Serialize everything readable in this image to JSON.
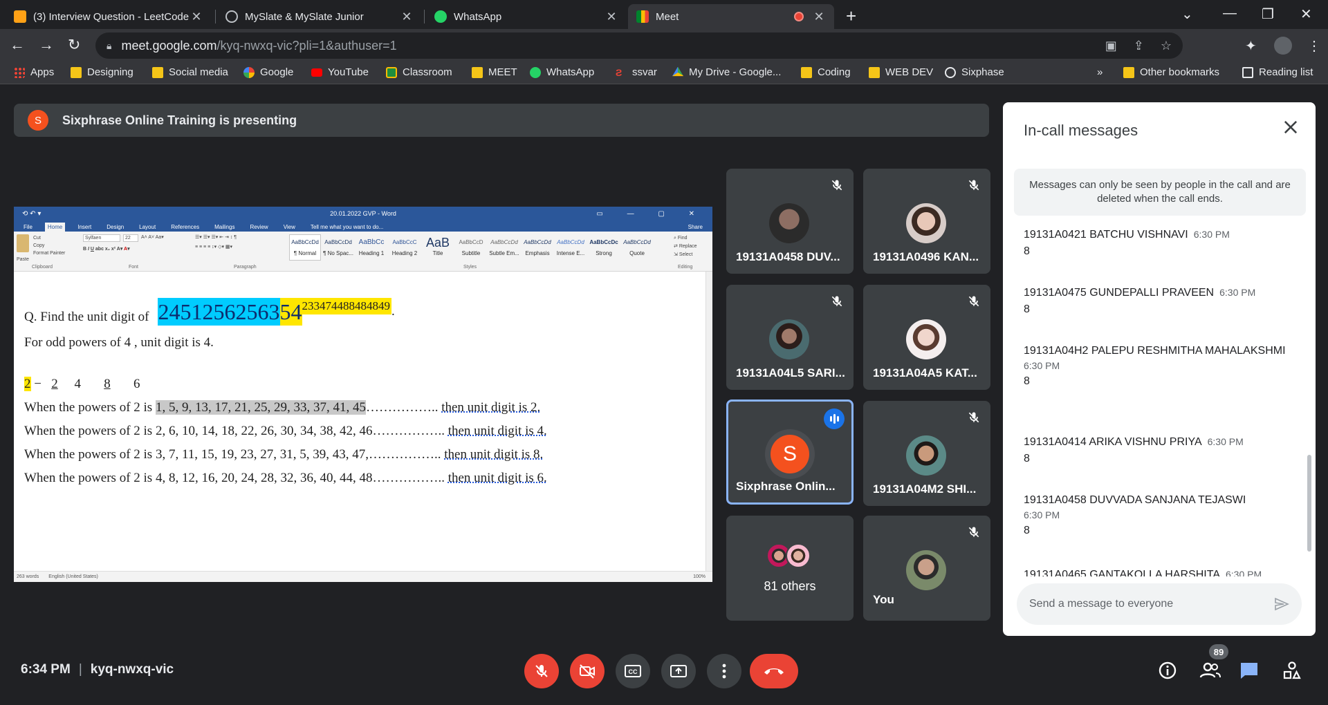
{
  "browser": {
    "tabs": [
      {
        "label": "(3) Interview Question - LeetCode",
        "icon": "leetcode-icon"
      },
      {
        "label": "MySlate & MySlate Junior",
        "icon": "globe-icon"
      },
      {
        "label": "WhatsApp",
        "icon": "whatsapp-icon"
      },
      {
        "label": "Meet",
        "icon": "meet-icon"
      }
    ],
    "url_host": "meet.google.com",
    "url_path": "/kyq-nwxq-vic?pli=1&authuser=1",
    "bookmarks": [
      {
        "label": "Apps"
      },
      {
        "label": "Designing"
      },
      {
        "label": "Social media"
      },
      {
        "label": "Google"
      },
      {
        "label": "YouTube"
      },
      {
        "label": "Classroom"
      },
      {
        "label": "MEET"
      },
      {
        "label": "WhatsApp"
      },
      {
        "label": "ssvar"
      },
      {
        "label": "My Drive - Google..."
      },
      {
        "label": "Coding"
      },
      {
        "label": "WEB DEV"
      },
      {
        "label": "Sixphase"
      }
    ],
    "overflow": "»",
    "other_bookmarks": "Other bookmarks",
    "reading_list": "Reading list"
  },
  "presenting": {
    "avatar_letter": "S",
    "text": "Sixphrase Online Training is presenting"
  },
  "word": {
    "title": "20.01.2022 GVP - Word",
    "tabs": [
      "File",
      "Home",
      "Insert",
      "Design",
      "Layout",
      "References",
      "Mailings",
      "Review",
      "View",
      "Tell me what you want to do..."
    ],
    "share": "Share",
    "font": "Sylfaen",
    "font_size": "22",
    "clipboard_items": [
      "Cut",
      "Copy",
      "Format Painter"
    ],
    "paste": "Paste",
    "group_labels": [
      "Clipboard",
      "Font",
      "Paragraph",
      "Styles",
      "Editing"
    ],
    "styles": [
      {
        "sample": "AaBbCcDd",
        "name": "¶ Normal"
      },
      {
        "sample": "AaBbCcDd",
        "name": "¶ No Spac..."
      },
      {
        "sample": "AaBbCc",
        "name": "Heading 1"
      },
      {
        "sample": "AaBbCcC",
        "name": "Heading 2"
      },
      {
        "sample": "AaB",
        "name": "Title"
      },
      {
        "sample": "AaBbCcD",
        "name": "Subtitle"
      },
      {
        "sample": "AaBbCcDd",
        "name": "Subtle Em..."
      },
      {
        "sample": "AaBbCcDd",
        "name": "Emphasis"
      },
      {
        "sample": "AaBbCcDd",
        "name": "Intense E..."
      },
      {
        "sample": "AaBbCcDc",
        "name": "Strong"
      },
      {
        "sample": "AaBbCcDd",
        "name": "Quote"
      }
    ],
    "editing": [
      "Find",
      "Replace",
      "Select"
    ],
    "question_prefix": "Q. Find the unit digit of",
    "question_number": "24512562563",
    "question_base": "54",
    "question_exponent": "233474488484849",
    "question_period": ".",
    "line_odd": "For odd powers of 4 , unit digit is 4.",
    "cycle": [
      "2",
      "−",
      "2",
      "4",
      "8",
      "6"
    ],
    "rules": [
      {
        "pre": "When the powers of 2 is ",
        "list": "1, 5, 9, 13, 17, 21, 25, 29, 33, 37, 41, 45",
        "dots": "……………..",
        "post": "then unit digit is 2."
      },
      {
        "pre": "When the powers of 2 is ",
        "list": "2, 6, 10, 14, 18, 22, 26, 30, 34, 38, 42, 46",
        "dots": "……………..",
        "post": "then unit digit is 4."
      },
      {
        "pre": "When the powers of 2 is ",
        "list": "3, 7, 11, 15, 19, 23, 27, 31, 5, 39, 43, 47,",
        "dots": "……………..",
        "post": "then unit digit is 8."
      },
      {
        "pre": "When the powers of 2 is ",
        "list": "4, 8, 12, 16, 20, 24, 28, 32, 36, 40, 44, 48",
        "dots": "……………..",
        "post": "then unit digit is 6."
      }
    ],
    "status_words": "263 words",
    "status_lang": "English (United States)",
    "zoom": "100%"
  },
  "tiles": [
    {
      "name": "19131A0458 DUV...",
      "muted": true,
      "avatar_color": "#8d6e63"
    },
    {
      "name": "19131A0496 KAN...",
      "muted": true,
      "avatar_color": "#d7ccc8"
    },
    {
      "name": "19131A04L5 SARI...",
      "muted": true,
      "avatar_color": "#4a6b6f"
    },
    {
      "name": "19131A04A5 KAT...",
      "muted": true,
      "avatar_color": "#e6d5cf"
    },
    {
      "name": "Sixphrase Onlin...",
      "muted": false,
      "avatar_letter": "S",
      "speaking": true
    },
    {
      "name": "19131A04M2 SHI...",
      "muted": true,
      "avatar_color": "#5b8a87"
    },
    {
      "name": "81 others",
      "muted": false
    },
    {
      "name": "You",
      "muted": true,
      "avatar_color": "#7a8a6a"
    }
  ],
  "chat": {
    "title": "In-call messages",
    "notice": "Messages can only be seen by people in the call and are deleted when the call ends.",
    "messages": [
      {
        "sender": "19131A0421 BATCHU VISHNAVI",
        "time": "6:30 PM",
        "text": "8"
      },
      {
        "sender": "19131A0475 GUNDEPALLI PRAVEEN",
        "time": "6:30 PM",
        "text": "8"
      },
      {
        "sender": "19131A04H2 PALEPU RESHMITHA MAHALAKSHMI",
        "time": "6:30 PM",
        "text": "8"
      },
      {
        "sender": "19131A0414 ARIKA VISHNU PRIYA",
        "time": "6:30 PM",
        "text": "8"
      },
      {
        "sender": "19131A0458 DUVVADA SANJANA TEJASWI",
        "time": "6:30 PM",
        "text": "8"
      },
      {
        "sender": "19131A0465 GANTAKOLLA HARSHITA",
        "time": "6:30 PM",
        "text": ""
      }
    ],
    "input_placeholder": "Send a message to everyone"
  },
  "bottom": {
    "time": "6:34 PM",
    "separator": "|",
    "meeting_code": "kyq-nwxq-vic",
    "participants_count": "89"
  },
  "colors": {
    "meet_bg": "#202124",
    "tile_bg": "#3c4043",
    "red": "#ea4335",
    "blue": "#1a73e8",
    "word_blue": "#2b579a",
    "highlight_cyan": "#00ccff",
    "highlight_yellow": "#ffe600"
  }
}
